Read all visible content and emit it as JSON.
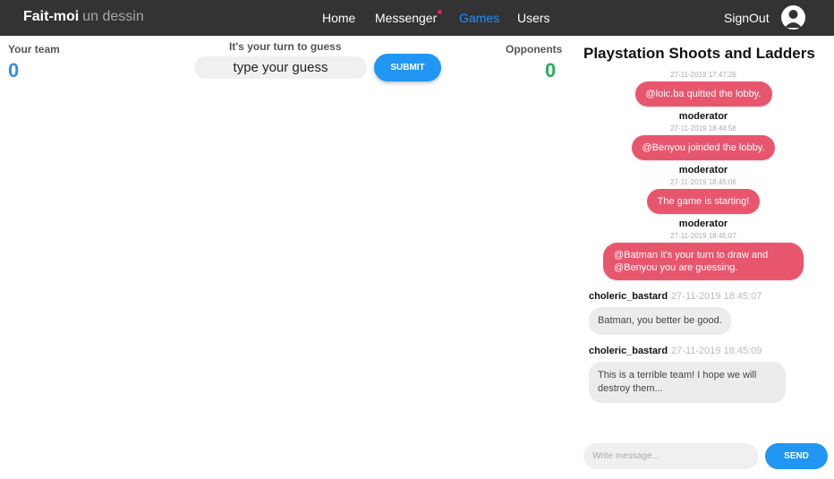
{
  "brand": {
    "bold": "Fait-moi",
    "light": "un dessin"
  },
  "nav": {
    "home": "Home",
    "messenger": "Messenger",
    "games": "Games",
    "users": "Users",
    "signout": "SignOut"
  },
  "colors": {
    "accent": "#2196f3",
    "your_team": "#3a8fd6",
    "opponents": "#27ae60",
    "moderator_bubble": "#e8566e",
    "notification_dot": "#e82440"
  },
  "game": {
    "your_team_label": "Your team",
    "your_team_score": "0",
    "turn_text": "It's your turn to guess",
    "guess_placeholder": "type your guess",
    "submit_label": "SUBMIT",
    "opponents_label": "Opponents",
    "opponents_score": "0"
  },
  "chat": {
    "title": "Playstation Shoots and Ladders",
    "moderator_messages": [
      {
        "time": "27-11-2019 17:47:26",
        "text": "@loic.ba quitted the lobby.",
        "author": "moderator"
      },
      {
        "time": "27-11-2019 18:44:56",
        "text": "@Benyou joinded the lobby.",
        "author": "moderator"
      },
      {
        "time": "27-11-2019 18:45:06",
        "text": "The game is starting!",
        "author": "moderator"
      },
      {
        "time": "27-11-2019 18:45:07",
        "text": "@Batman it's your turn to draw and @Benyou you are guessing."
      }
    ],
    "user_messages": [
      {
        "author": "choleric_bastard",
        "time": "27-11-2019 18:45:07",
        "text": "Batman, you better be good."
      },
      {
        "author": "choleric_bastard",
        "time": "27-11-2019 18:45:09",
        "text": "This is a terrible team! I hope we will destroy them..."
      }
    ],
    "input_placeholder": "Write message...",
    "send_label": "SEND"
  }
}
